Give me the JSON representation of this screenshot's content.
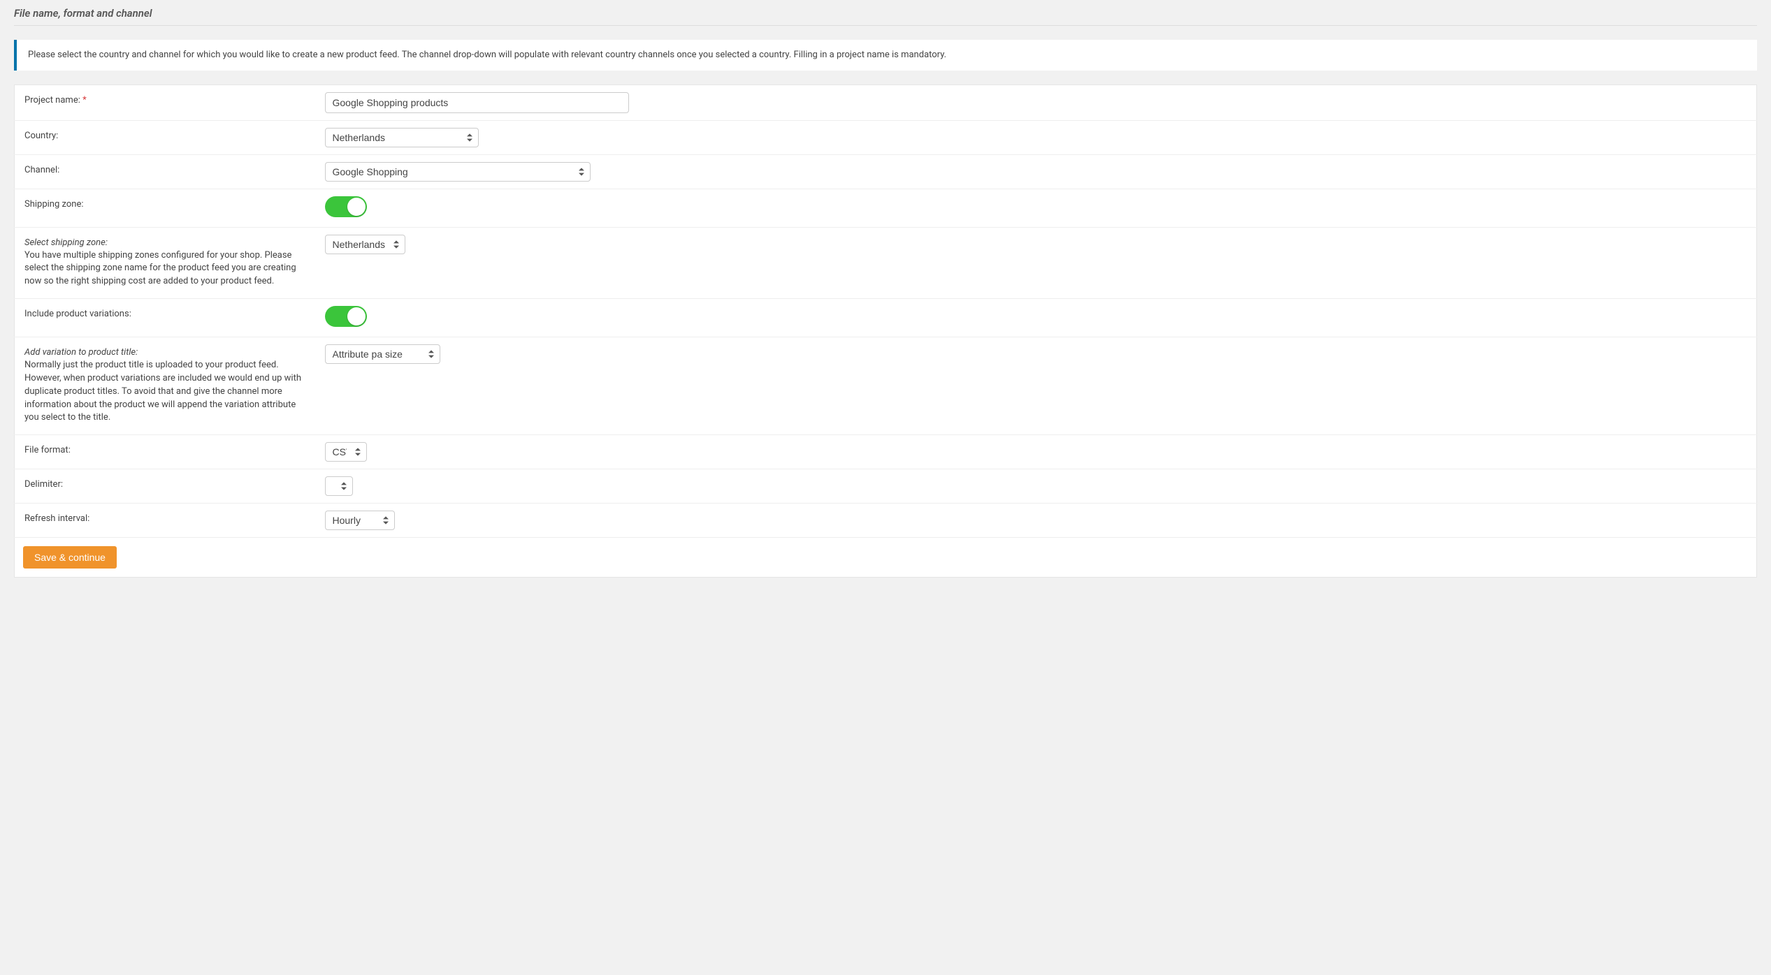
{
  "section_title": "File name, format and channel",
  "info_text": "Please select the country and channel for which you would like to create a new product feed. The channel drop-down will populate with relevant country channels once you selected a country. Filling in a project name is mandatory.",
  "fields": {
    "project_name": {
      "label": "Project name:",
      "required_mark": "*",
      "value": "Google Shopping products"
    },
    "country": {
      "label": "Country:",
      "value": "Netherlands"
    },
    "channel": {
      "label": "Channel:",
      "value": "Google Shopping"
    },
    "shipping_zone_toggle": {
      "label": "Shipping zone:",
      "on": true
    },
    "select_shipping_zone": {
      "title": "Select shipping zone:",
      "desc": "You have multiple shipping zones configured for your shop. Please select the shipping zone name for the product feed you are creating now so the right shipping cost are added to your product feed.",
      "value": "Netherlands"
    },
    "include_variations_toggle": {
      "label": "Include product variations:",
      "on": true
    },
    "add_variation_title": {
      "title": "Add variation to product title:",
      "desc": "Normally just the product title is uploaded to your product feed. However, when product variations are included we would end up with duplicate product titles. To avoid that and give the channel more information about the product we will append the variation attribute you select to the title.",
      "value": "Attribute pa size"
    },
    "file_format": {
      "label": "File format:",
      "value": "CSV"
    },
    "delimiter": {
      "label": "Delimiter:",
      "value": ";"
    },
    "refresh_interval": {
      "label": "Refresh interval:",
      "value": "Hourly"
    }
  },
  "buttons": {
    "save_continue": "Save & continue"
  }
}
